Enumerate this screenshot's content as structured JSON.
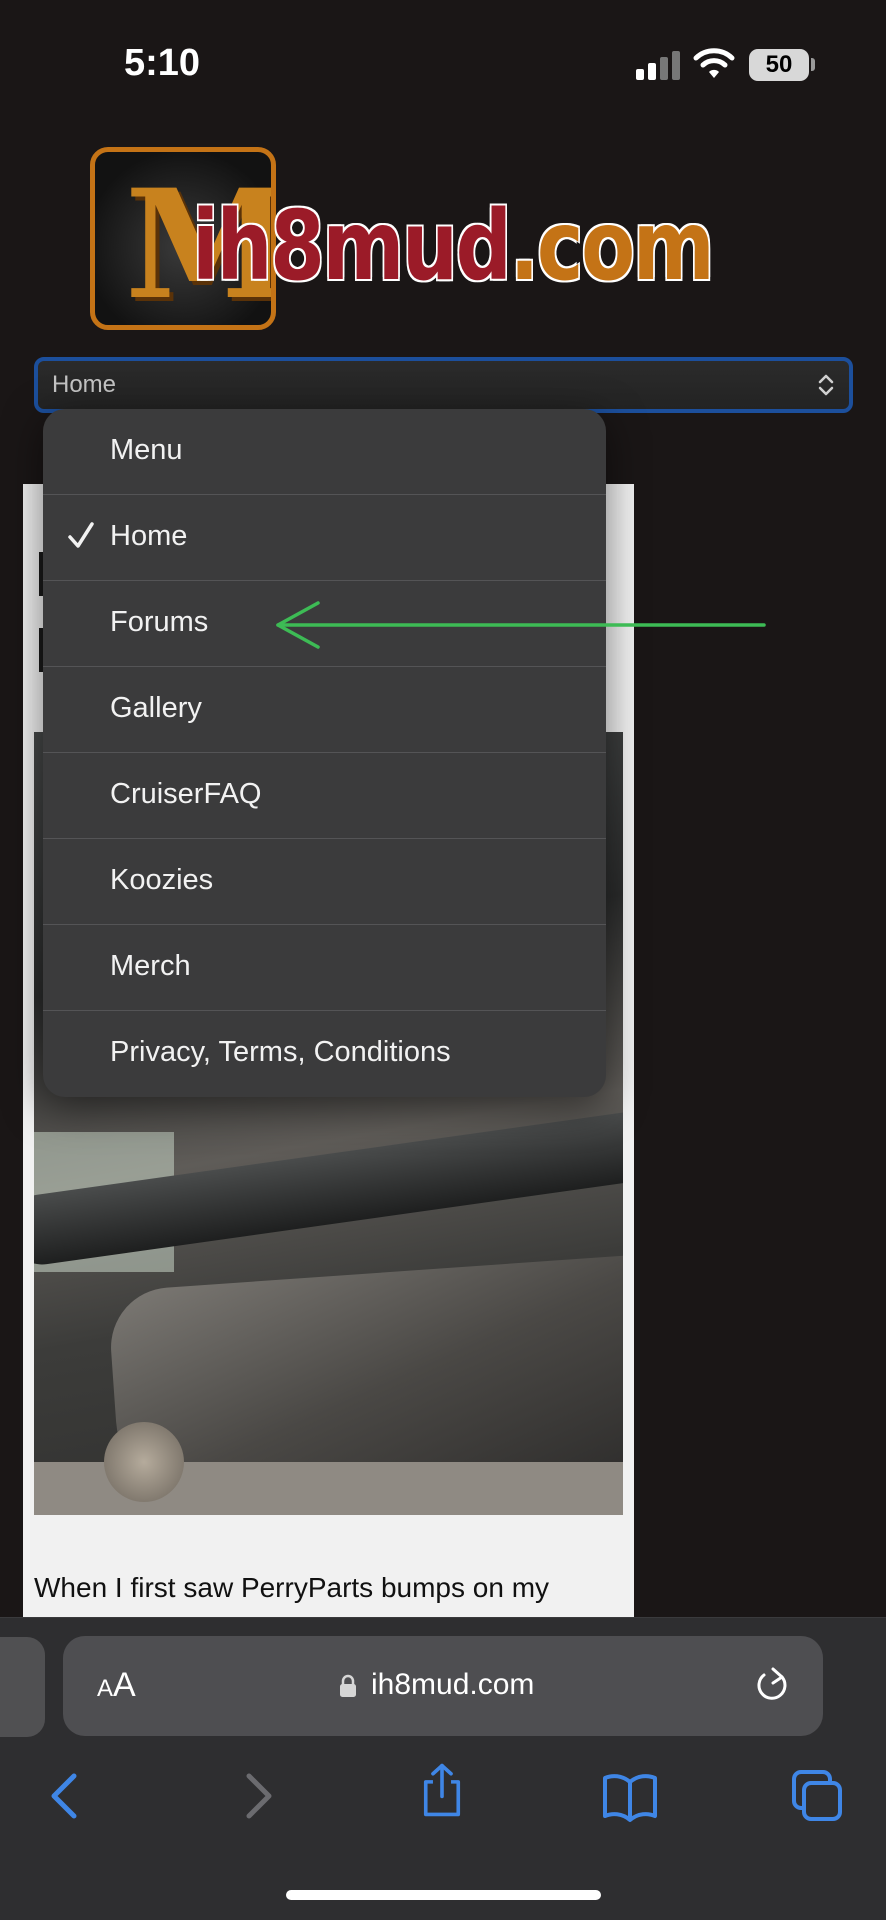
{
  "status_bar": {
    "time": "5:10",
    "battery": "50"
  },
  "site": {
    "logo_prefix": "ih8mud",
    "logo_suffix": ".com"
  },
  "nav_select": {
    "selected_value": "Home"
  },
  "dropdown": {
    "options": [
      {
        "label": "Menu",
        "selected": false
      },
      {
        "label": "Home",
        "selected": true
      },
      {
        "label": "Forums",
        "selected": false
      },
      {
        "label": "Gallery",
        "selected": false
      },
      {
        "label": "CruiserFAQ",
        "selected": false
      },
      {
        "label": "Koozies",
        "selected": false
      },
      {
        "label": "Merch",
        "selected": false
      },
      {
        "label": "Privacy, Terms, Conditions",
        "selected": false
      }
    ]
  },
  "article": {
    "first_line": "When I first saw PerryParts bumps on my"
  },
  "browser": {
    "text_size_small": "A",
    "text_size_large": "A",
    "url": "ih8mud.com",
    "tint_color": "#3f86e6",
    "disabled_color": "#6b6b6f"
  },
  "annotation": {
    "color": "#3dbb55",
    "icon": "arrow-left-icon"
  }
}
